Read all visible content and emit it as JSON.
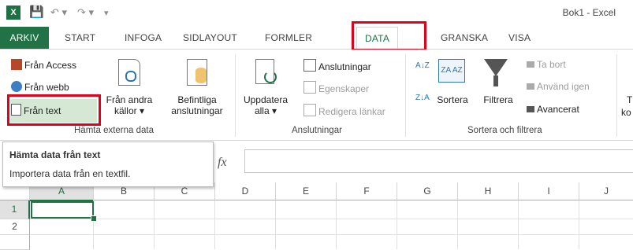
{
  "title": "Bok1 - Excel",
  "tabs": [
    "ARKIV",
    "START",
    "INFOGA",
    "SIDLAYOUT",
    "FORMLER",
    "DATA",
    "GRANSKA",
    "VISA"
  ],
  "active_tab": "DATA",
  "ribbon": {
    "external": {
      "from_access": "Från Access",
      "from_web": "Från webb",
      "from_text": "Från text",
      "other_sources_1": "Från andra",
      "other_sources_2": "källor ▾",
      "existing_1": "Befintliga",
      "existing_2": "anslutningar",
      "group": "Hämta externa data"
    },
    "connections": {
      "refresh_1": "Uppdatera",
      "refresh_2": "alla ▾",
      "connections": "Anslutningar",
      "properties": "Egenskaper",
      "edit_links": "Redigera länkar",
      "group": "Anslutningar"
    },
    "sort": {
      "sort": "Sortera",
      "filter": "Filtrera",
      "clear": "Ta bort",
      "reapply": "Använd igen",
      "advanced": "Avancerat",
      "group": "Sortera och filtrera",
      "az": "A↓Z",
      "za": "Z↓A"
    },
    "partial": {
      "t1": "T",
      "t2": "ko"
    }
  },
  "tooltip": {
    "title": "Hämta data från text",
    "body": "Importera data från en textfil."
  },
  "formula": {
    "fx": "fx",
    "value": ""
  },
  "columns": [
    "A",
    "B",
    "C",
    "D",
    "E",
    "F",
    "G",
    "H",
    "I",
    "J"
  ],
  "rows": [
    "1",
    "2",
    ""
  ],
  "colors": {
    "excel_green": "#217346",
    "highlight_red": "#e2001a"
  }
}
